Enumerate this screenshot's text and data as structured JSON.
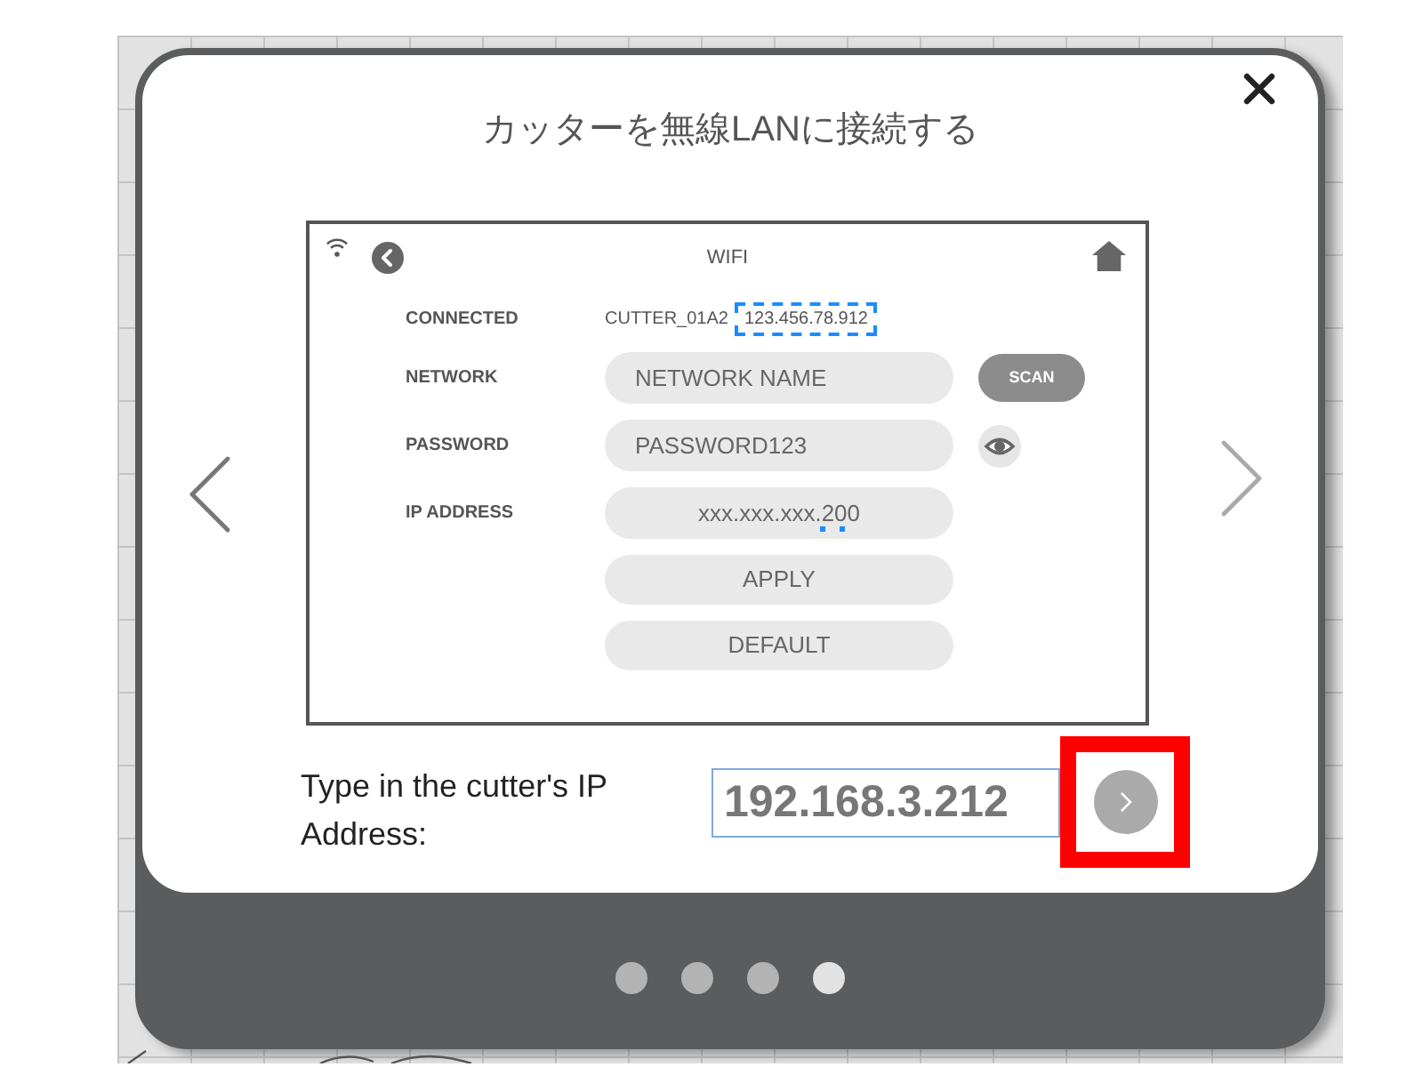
{
  "dialog": {
    "title": "カッターを無線LANに接続する"
  },
  "screenshot": {
    "title": "WIFI",
    "rows": [
      {
        "kind": "status",
        "label": "CONNECTED",
        "name": "CUTTER_01A2",
        "address": "123.456.78.912",
        "highlighted": true
      },
      {
        "kind": "field",
        "label": "NETWORK",
        "value": "NETWORK NAME",
        "action": {
          "kind": "button",
          "label": "SCAN"
        }
      },
      {
        "kind": "field",
        "label": "PASSWORD",
        "value": "PASSWORD123",
        "action": {
          "kind": "reveal"
        }
      },
      {
        "kind": "field",
        "label": "IP ADDRESS",
        "value": "xxx.xxx.xxx.200",
        "marked": true
      },
      {
        "kind": "button",
        "label": "APPLY"
      },
      {
        "kind": "button",
        "label": "DEFAULT"
      }
    ]
  },
  "prompt": {
    "label": "Type in the cutter's IP Address:",
    "value": "192.168.3.212",
    "next_highlighted": true
  },
  "pager": [
    {
      "selected": false
    },
    {
      "selected": false
    },
    {
      "selected": false
    },
    {
      "selected": true
    }
  ]
}
